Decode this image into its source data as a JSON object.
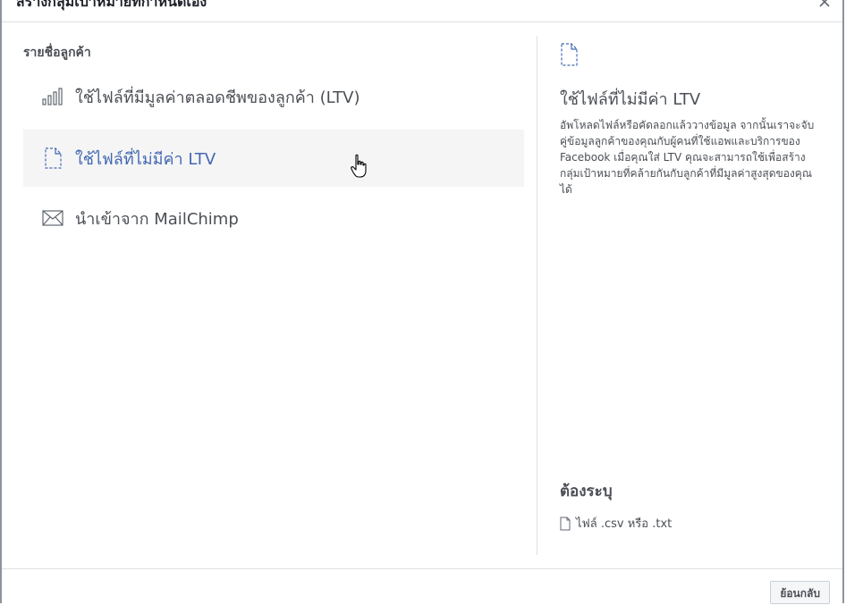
{
  "header": {
    "title": "สร้างกลุ่มเป้าหมายที่กำหนดเอง"
  },
  "left": {
    "section_label": "รายชื่อลูกค้า",
    "options": [
      {
        "label": "ใช้ไฟล์ที่มีมูลค่าตลอดชีพของลูกค้า (LTV)",
        "icon": "bar-chart-icon",
        "selected": false
      },
      {
        "label": "ใช้ไฟล์ที่ไม่มีค่า LTV",
        "icon": "file-icon",
        "selected": true
      },
      {
        "label": "นำเข้าจาก MailChimp",
        "icon": "envelope-icon",
        "selected": false
      }
    ]
  },
  "right": {
    "icon": "file-icon",
    "title": "ใช้ไฟล์ที่ไม่มีค่า LTV",
    "description": "อัพโหลดไฟล์หรือคัดลอกแล้ววางข้อมูล จากนั้นเราจะจับคู่ข้อมูลลูกค้าของคุณกับผู้คนที่ใช้แอพและบริการของ Facebook เมื่อคุณใส่ LTV คุณจะสามารถใช้เพื่อสร้างกลุ่มเป้าหมายที่คล้ายกันกับลูกค้าที่มีมูลค่าสูงสุดของคุณได้",
    "requirements_title": "ต้องระบุ",
    "requirements": [
      {
        "label": "ไฟล์ .csv หรือ .txt",
        "icon": "file-icon"
      }
    ]
  },
  "footer": {
    "back_label": "ย้อนกลับ"
  },
  "colors": {
    "accent": "#4267b2",
    "text": "#4b4f56",
    "selected_bg": "#f5f5f5",
    "border": "#dddfe2"
  }
}
